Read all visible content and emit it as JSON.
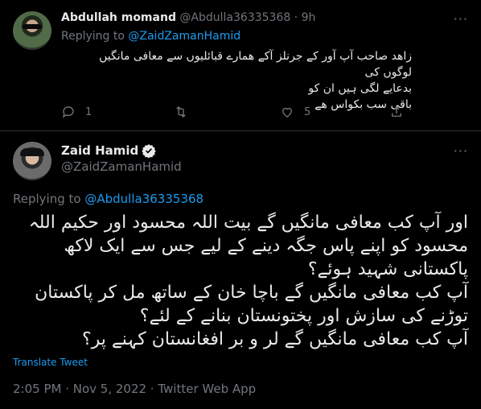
{
  "reply_tweet": {
    "name": "Abdullah momand",
    "handle": "@Abdulla36335368",
    "time": "9h",
    "replying_label": "Replying to",
    "replying_to": "@ZaidZamanHamid",
    "text_lines": [
      "زاھد صاحب آپ آور کے جرنلز آکے ھمارے قبائلیوں سے معافی مانگیں لوگوں کی",
      "بدعایے لگی ہیں ان کو",
      "باقی سب بکواس ھے"
    ],
    "actions": {
      "reply_count": "1",
      "retweet_count": "",
      "like_count": "5"
    },
    "more_icon": "more-icon"
  },
  "main_tweet": {
    "name": "Zaid Hamid",
    "handle": "@ZaidZamanHamid",
    "verified_icon": "verified-badge-icon",
    "replying_label": "Replying to",
    "replying_to": "@Abdulla36335368",
    "text_lines": [
      "اور آپ کب معافی مانگیں گے بیت اللہ محسود اور حکیم اللہ",
      "محسود کو اپنے پاس جگہ دینے کے لیے جس سے ایک لاکھ",
      "پاکستانی شہید ہوئے؟",
      "آپ کب معافی مانگیں گے باچا خان کے ساتھ مل کر پاکستان",
      "توڑنے کی سازش اور پختونستان بنانے کے لئے؟",
      "آپ کب معافی مانگیں گے لر و بر افغانستان کہنے پر؟"
    ],
    "translate_label": "Translate Tweet",
    "timestamp": "2:05 PM · Nov 5, 2022 · Twitter Web App"
  },
  "colors": {
    "background": "#000000",
    "text": "#e7e9ea",
    "muted": "#71767b",
    "accent": "#1d9bf0",
    "divider": "#2f3336"
  }
}
